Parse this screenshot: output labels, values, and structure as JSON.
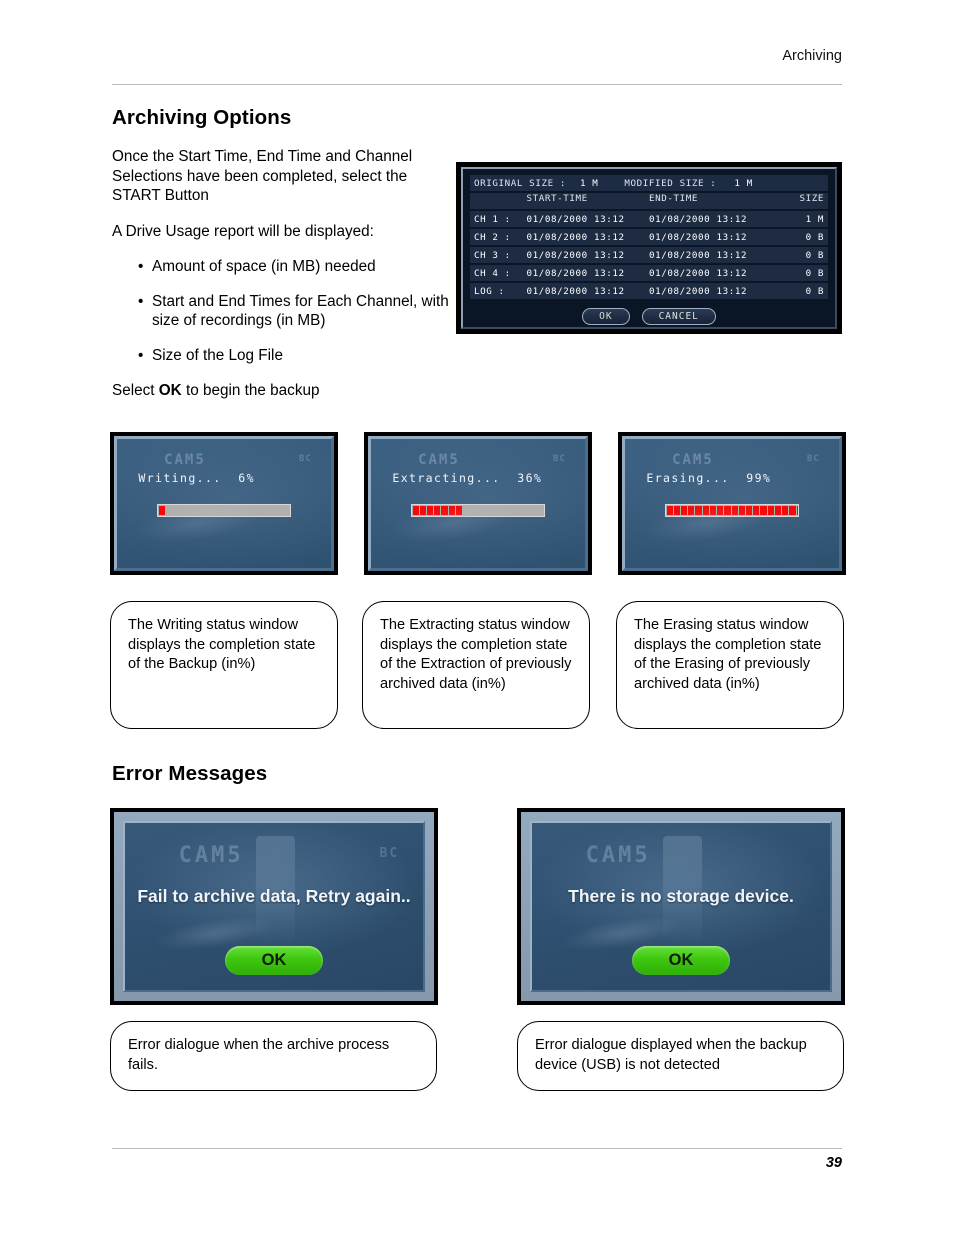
{
  "header": {
    "running_head": "Archiving",
    "page_number": "39"
  },
  "sections": {
    "archiving_options": {
      "title": "Archiving Options",
      "paragraphs": [
        "Once the Start Time, End Time and Channel Selections have been completed, select the START Button",
        "A Drive Usage report will be displayed:"
      ],
      "bullets": [
        "Amount of space (in MB) needed",
        "Start and End Times for Each Channel, with size of recordings (in MB)",
        "Size of the Log File"
      ],
      "closing_prefix": "Select ",
      "closing_strong": "OK",
      "closing_suffix": " to begin the backup"
    },
    "error_messages": {
      "title": "Error Messages"
    }
  },
  "archive_dialog": {
    "original_size_label": "ORIGINAL SIZE :",
    "original_size_value": "1 M",
    "modified_size_label": "MODIFIED SIZE :",
    "modified_size_value": "1 M",
    "columns": {
      "channel": "",
      "start_time": "START-TIME",
      "end_time": "END-TIME",
      "size": "SIZE"
    },
    "rows": [
      {
        "channel": "CH 1 :",
        "start_time": "01/08/2000  13:12",
        "end_time": "01/08/2000  13:12",
        "size": "1 M"
      },
      {
        "channel": "CH 2 :",
        "start_time": "01/08/2000  13:12",
        "end_time": "01/08/2000  13:12",
        "size": "0 B"
      },
      {
        "channel": "CH 3 :",
        "start_time": "01/08/2000  13:12",
        "end_time": "01/08/2000  13:12",
        "size": "0 B"
      },
      {
        "channel": "CH 4 :",
        "start_time": "01/08/2000  13:12",
        "end_time": "01/08/2000  13:12",
        "size": "0 B"
      }
    ],
    "log_row": {
      "channel": "LOG  :",
      "start_time": "01/08/2000  13:12",
      "end_time": "01/08/2000  13:12",
      "size": "0 B"
    },
    "ok_label": "OK",
    "cancel_label": "CANCEL"
  },
  "progress_windows": [
    {
      "osd_cam": "CAM5",
      "osd_right": "BC",
      "status_text": "Writing...  6%",
      "operation": "Writing",
      "percent": 6,
      "segments": 1,
      "bar_fill_color": "#f30b0b",
      "bar_track_color": "#b0b0b0",
      "caption": "The Writing status window displays the completion state of the Backup (in%)"
    },
    {
      "osd_cam": "CAM5",
      "osd_right": "BC",
      "status_text": "Extracting...  36%",
      "operation": "Extracting",
      "percent": 36,
      "segments": 7,
      "bar_fill_color": "#f30b0b",
      "bar_track_color": "#b0b0b0",
      "caption": "The Extracting status window displays the completion state of the Extraction of previously archived data (in%)"
    },
    {
      "osd_cam": "CAM5",
      "osd_right": "BC",
      "status_text": "Erasing...  99%",
      "operation": "Erasing",
      "percent": 99,
      "segments": 21,
      "bar_fill_color": "#f30b0b",
      "bar_track_color": "#b0b0b0",
      "caption": "The Erasing status window displays the completion state of the Erasing of previously archived data (in%)"
    }
  ],
  "error_dialogs": [
    {
      "osd_cam": "CAM5",
      "osd_right": "BC",
      "message": "Fail to archive data, Retry again..",
      "ok_label": "OK",
      "ok_color": "#3ec70f",
      "caption": "Error dialogue when the archive process fails."
    },
    {
      "osd_cam": "CAM5",
      "osd_right": "",
      "message": "There is no storage device.",
      "ok_label": "OK",
      "ok_color": "#3ec70f",
      "caption": "Error dialogue displayed when the backup device (USB) is not detected"
    }
  ]
}
